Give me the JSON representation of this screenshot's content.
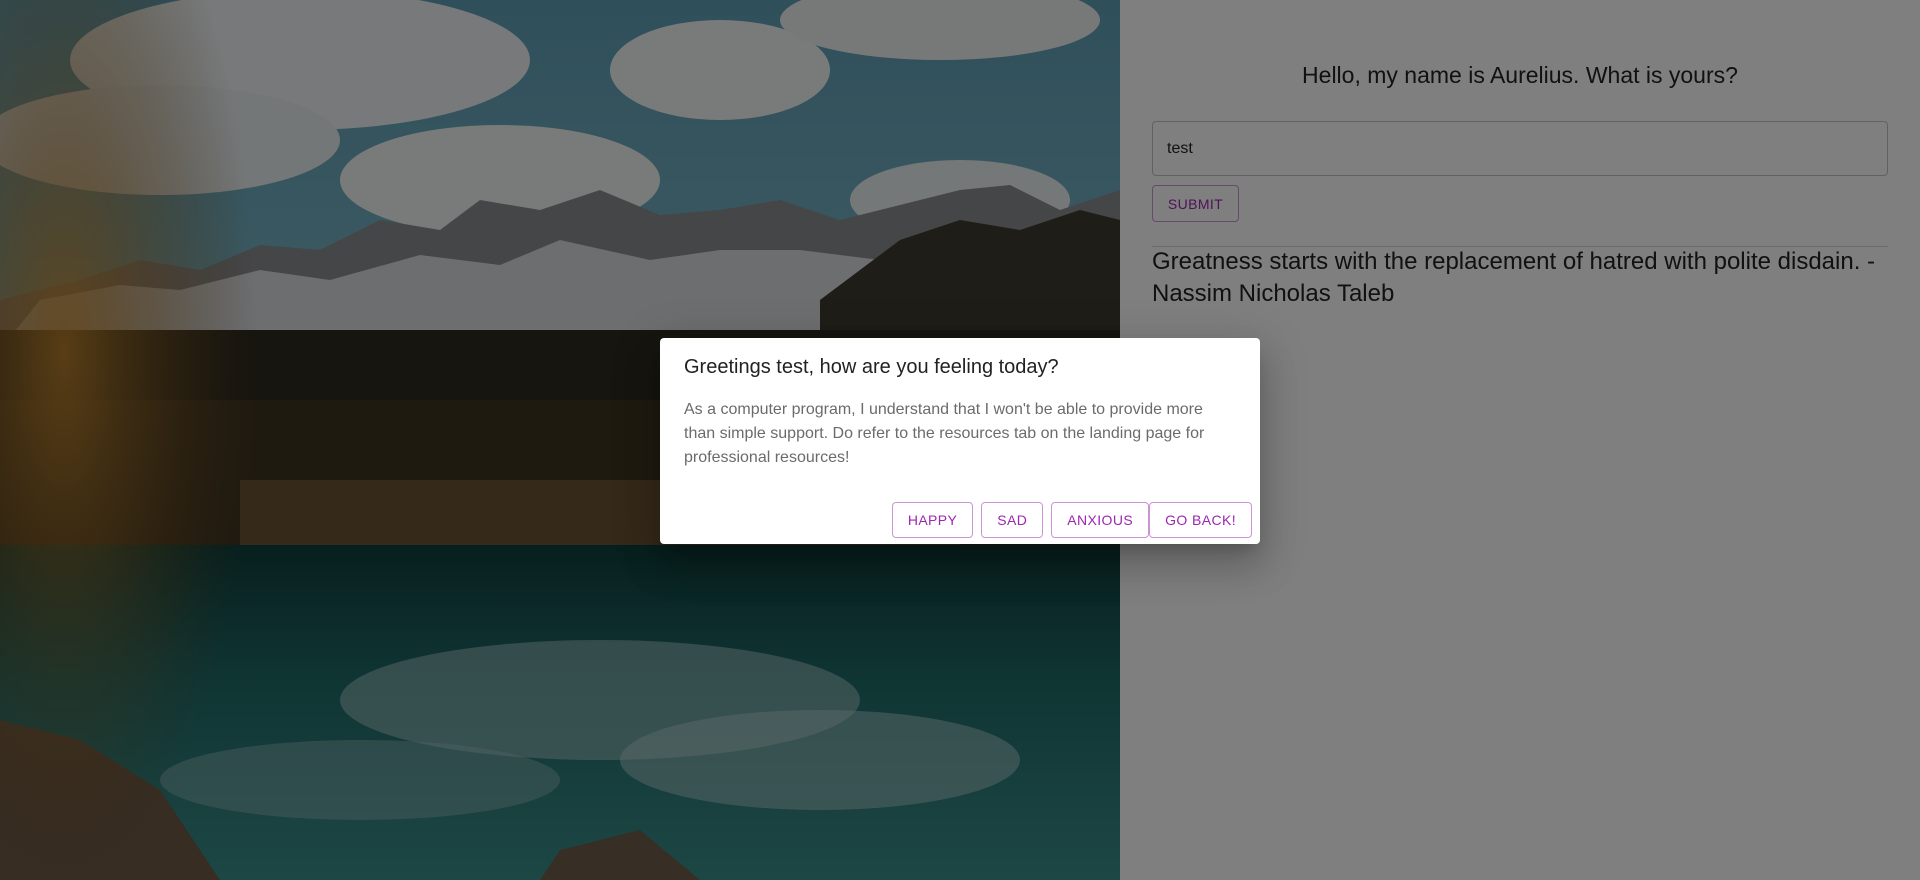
{
  "main": {
    "greeting": "Hello, my name is Aurelius. What is yours?",
    "name_input_value": "test",
    "submit_label": "SUBMIT",
    "quote": "Greatness starts with the replacement of hatred with polite disdain. - Nassim Nicholas Taleb"
  },
  "dialog": {
    "title": "Greetings test, how are you feeling today?",
    "text": "As a computer program, I understand that I won't be able to provide more than simple support. Do refer to the resources tab on the landing page for professional resources!",
    "buttons": {
      "happy": "HAPPY",
      "sad": "SAD",
      "anxious": "ANXIOUS",
      "go_back": "GO BACK!"
    }
  },
  "colors": {
    "accent": "#9c27b0",
    "backdrop": "rgba(0,0,0,0.5)"
  }
}
